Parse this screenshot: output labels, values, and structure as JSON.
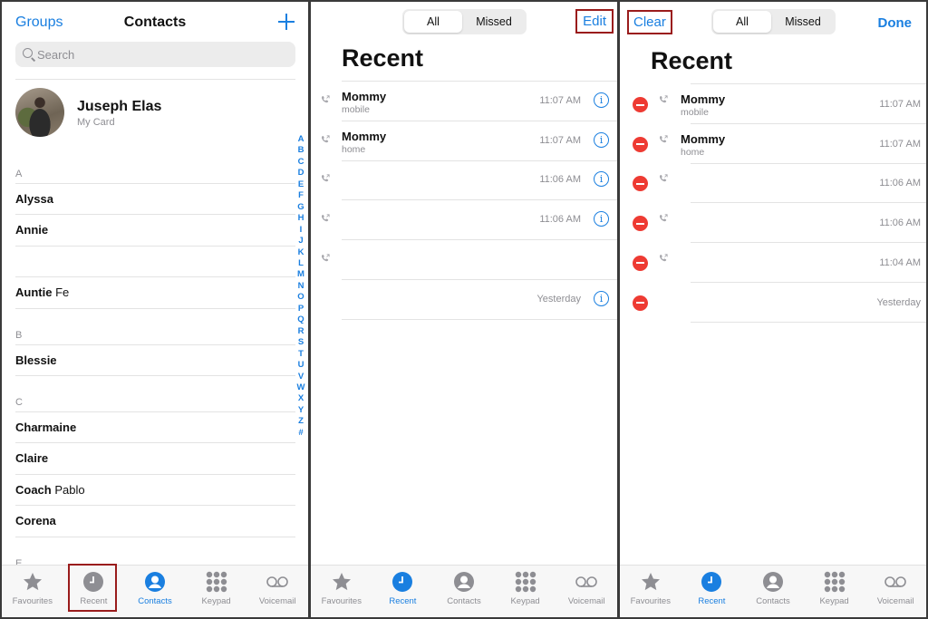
{
  "colors": {
    "accent": "#1a7fe0",
    "delete": "#ee3b33",
    "highlight_frame": "#9a1c1c",
    "secondary_text": "#8e8e93"
  },
  "contacts_screen": {
    "nav": {
      "left": "Groups",
      "title": "Contacts",
      "add_icon": "plus-icon"
    },
    "search": {
      "placeholder": "Search"
    },
    "my_card": {
      "name": "Juseph Elas",
      "subtitle": "My Card"
    },
    "sections": [
      {
        "letter": "A",
        "rows": [
          {
            "first": "Alyssa",
            "last": ""
          },
          {
            "first": "Annie",
            "last": ""
          },
          {
            "first": "",
            "last": ""
          },
          {
            "first": "Auntie",
            "last": "Fe"
          }
        ]
      },
      {
        "letter": "B",
        "rows": [
          {
            "first": "Blessie",
            "last": ""
          }
        ]
      },
      {
        "letter": "C",
        "rows": [
          {
            "first": "Charmaine",
            "last": ""
          },
          {
            "first": "Claire",
            "last": ""
          },
          {
            "first": "Coach",
            "last": "Pablo"
          },
          {
            "first": "Corena",
            "last": ""
          }
        ]
      },
      {
        "letter": "E",
        "rows": []
      }
    ],
    "index": [
      "A",
      "B",
      "C",
      "D",
      "E",
      "F",
      "G",
      "H",
      "I",
      "J",
      "K",
      "L",
      "M",
      "N",
      "O",
      "P",
      "Q",
      "R",
      "S",
      "T",
      "U",
      "V",
      "W",
      "X",
      "Y",
      "Z",
      "#"
    ],
    "active_tab": "Contacts",
    "highlighted_tab": "Recent"
  },
  "recent_screen": {
    "segments": [
      "All",
      "Missed"
    ],
    "selected_segment": "All",
    "edit_label": "Edit",
    "title": "Recent",
    "calls": [
      {
        "name": "Mommy",
        "type": "mobile",
        "time": "11:07 AM",
        "outgoing": true
      },
      {
        "name": "Mommy",
        "type": "home",
        "time": "11:07 AM",
        "outgoing": true
      },
      {
        "name": "",
        "type": "",
        "time": "11:06 AM",
        "outgoing": true
      },
      {
        "name": "",
        "type": "",
        "time": "11:06 AM",
        "outgoing": true
      },
      {
        "name": "",
        "type": "",
        "time": "",
        "outgoing": true
      },
      {
        "name": "",
        "type": "",
        "time": "Yesterday",
        "outgoing": false
      }
    ],
    "active_tab": "Recent"
  },
  "recent_edit_screen": {
    "clear_label": "Clear",
    "done_label": "Done",
    "segments": [
      "All",
      "Missed"
    ],
    "selected_segment": "All",
    "title": "Recent",
    "calls": [
      {
        "name": "Mommy",
        "type": "mobile",
        "time": "11:07 AM",
        "outgoing": true
      },
      {
        "name": "Mommy",
        "type": "home",
        "time": "11:07 AM",
        "outgoing": true
      },
      {
        "name": "",
        "type": "",
        "time": "11:06 AM",
        "outgoing": true
      },
      {
        "name": "",
        "type": "",
        "time": "11:06 AM",
        "outgoing": true
      },
      {
        "name": "",
        "type": "",
        "time": "11:04 AM",
        "outgoing": true
      },
      {
        "name": "",
        "type": "",
        "time": "Yesterday",
        "outgoing": false
      }
    ],
    "active_tab": "Recent"
  },
  "tabs": [
    {
      "label": "Favourites",
      "icon": "star-icon"
    },
    {
      "label": "Recent",
      "icon": "clock-icon"
    },
    {
      "label": "Contacts",
      "icon": "person-icon"
    },
    {
      "label": "Keypad",
      "icon": "keypad-icon"
    },
    {
      "label": "Voicemail",
      "icon": "voicemail-icon"
    }
  ]
}
